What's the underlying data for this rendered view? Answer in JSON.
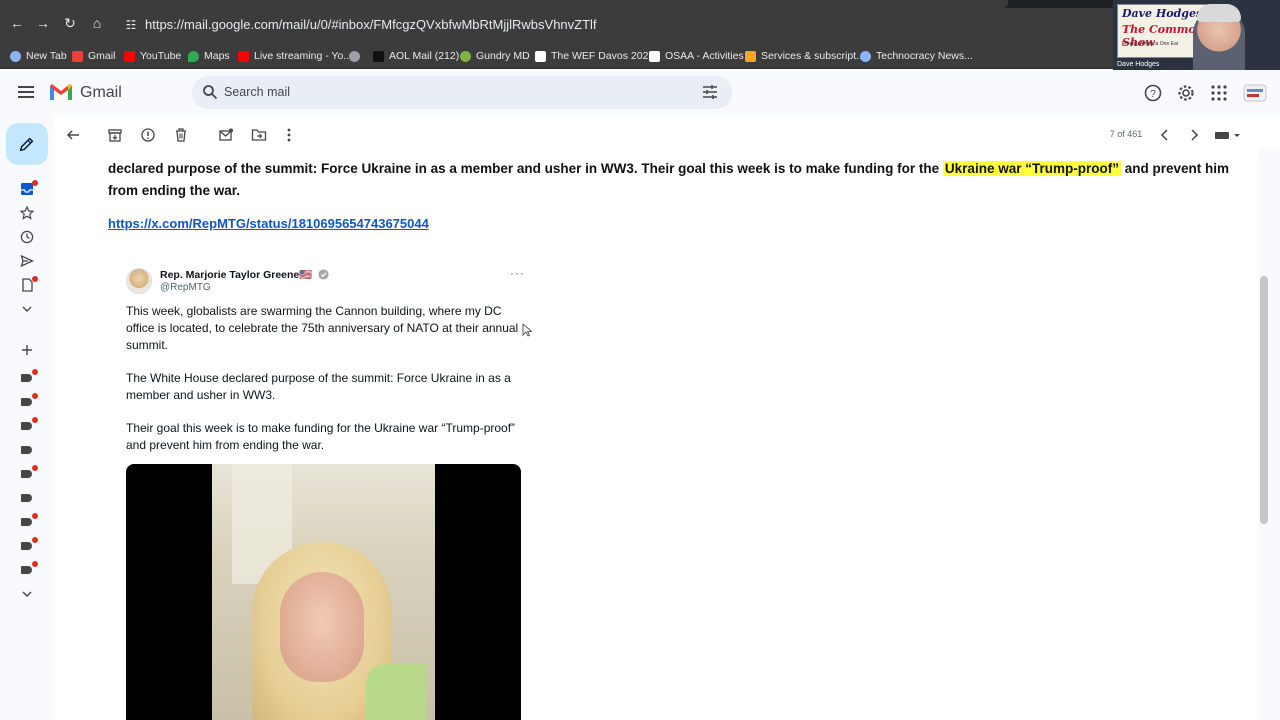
{
  "browser": {
    "url": "https://mail.google.com/mail/u/0/#inbox/FMfcgzQVxbfwMbRtMjjlRwbsVhnvZTlf",
    "bookmarks": [
      {
        "label": "New Tab",
        "color": "#8ab4f8"
      },
      {
        "label": "Gmail",
        "color": "#ea4335"
      },
      {
        "label": "YouTube",
        "color": "#ff0000"
      },
      {
        "label": "Maps",
        "color": "#34a853"
      },
      {
        "label": "Live streaming - Yo...",
        "color": "#ff0000"
      },
      {
        "label": "",
        "color": "#9aa0a6"
      },
      {
        "label": "AOL Mail (212)",
        "color": "#111111"
      },
      {
        "label": "Gundry MD",
        "color": "#7cb342"
      },
      {
        "label": "The WEF Davos 202...",
        "color": "#ffffff"
      },
      {
        "label": "OSAA - Activities",
        "color": "#ffffff"
      },
      {
        "label": "Services & subscript...",
        "color": "#f9a825"
      },
      {
        "label": "Technocracy News...",
        "color": "#8ab4f8"
      }
    ]
  },
  "overlay": {
    "logo_line1": "Dave Hodges",
    "logo_line2": "The Common",
    "logo_line2_end": "Show",
    "tagline": "Freeing America One Ear",
    "name": "Dave Hodges"
  },
  "gmail": {
    "app_name": "Gmail",
    "search_placeholder": "Search mail",
    "pager": "7 of 461"
  },
  "email": {
    "text_before": "declared purpose of the summit: Force Ukraine in as a member and usher in WW3. Their goal this week is to make funding for the ",
    "highlight": "Ukraine war “Trump-proof”",
    "text_after": " and prevent him from ending the war.",
    "link": "https://x.com/RepMTG/status/1810695654743675044",
    "tweet": {
      "name": "Rep. Marjorie Taylor Greene🇺🇸",
      "handle": "@RepMTG",
      "more": "···",
      "paragraphs": [
        "This week, globalists are swarming the Cannon building, where my DC office is located, to celebrate the 75th anniversary of NATO at their annual summit.",
        "The White House declared purpose of the summit: Force Ukraine in as a member and usher in WW3.",
        "Their goal this week is to make funding for the Ukraine war “Trump-proof” and prevent him from ending the war."
      ]
    }
  },
  "colors": {
    "highlight": "#ffff3a",
    "link": "#1155cc",
    "compose_bg": "#c2e7ff",
    "notification_dot": "#d93025"
  }
}
